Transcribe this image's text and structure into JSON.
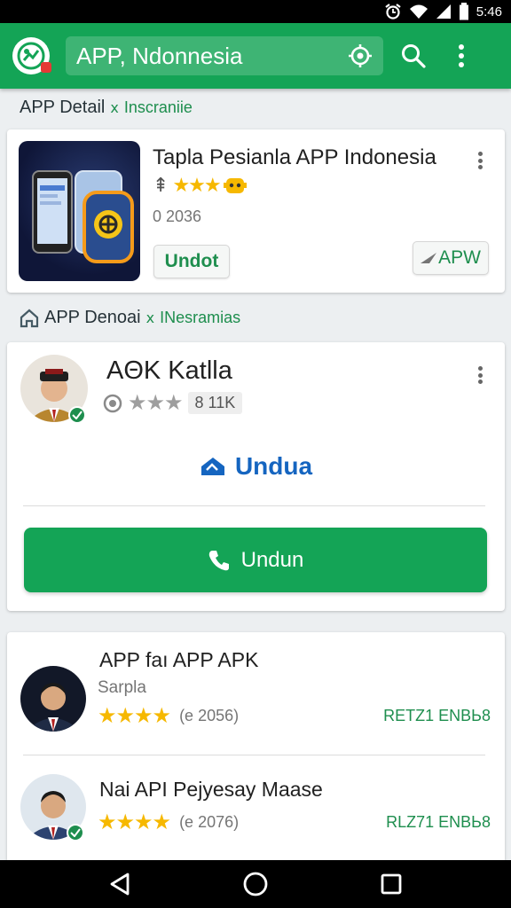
{
  "status_bar": {
    "time": "5:46"
  },
  "app_bar": {
    "search_text": "APP, Ndonnesia"
  },
  "section1": {
    "title": "APP Detail",
    "tag": "Inscraniie"
  },
  "card1": {
    "title": "Tapla Pesianla APP Indonesia",
    "count": "0 2036",
    "primary_button": "Undot",
    "secondary_button": "APW"
  },
  "section2": {
    "title": "APP Denoai",
    "tag": "INesramias"
  },
  "card2": {
    "name": "AΘK Katlla",
    "count": "8 11K",
    "action_link": "Undua",
    "install_button": "Undun"
  },
  "list": {
    "items": [
      {
        "title": "APP faı APP APK",
        "subtitle": "Sarpla",
        "count": "(e 2056)",
        "action": "RETZ1 ENBЬ8"
      },
      {
        "title": "Nai API Pejyesay Maase",
        "subtitle": "",
        "count": "(e 2076)",
        "action": "RLZ71 ENBЬ8"
      }
    ]
  },
  "colors": {
    "primary": "#14a456",
    "accent_blue": "#1565c0",
    "star": "#f6b800"
  },
  "icons": [
    "alarm-icon",
    "wifi-icon",
    "signal-icon",
    "battery-icon",
    "app-logo-icon",
    "location-target-icon",
    "search-icon",
    "more-vert-icon",
    "camera-icon",
    "download-icon",
    "phone-icon",
    "back-icon",
    "home-icon",
    "recents-icon"
  ]
}
